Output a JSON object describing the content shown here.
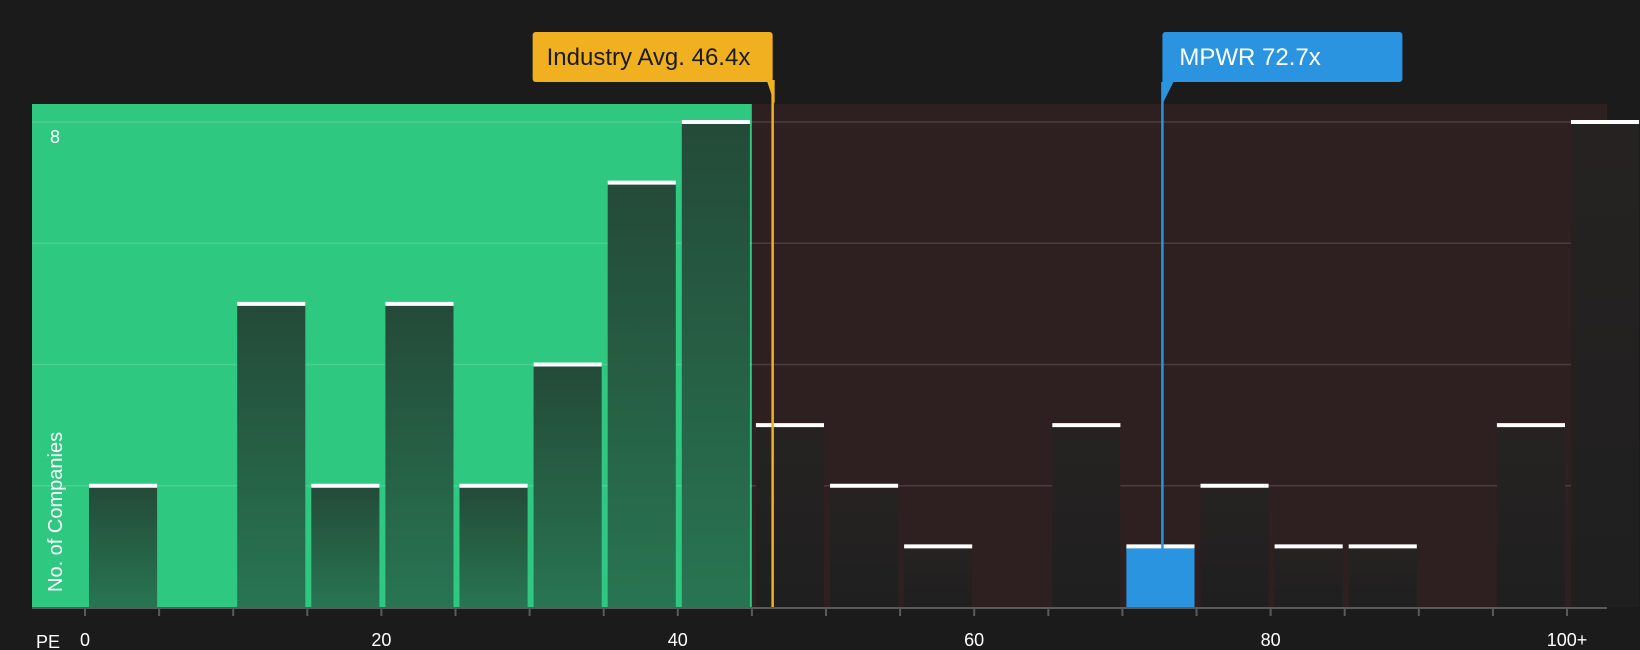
{
  "chart_data": {
    "type": "bar",
    "xlabel": "PE",
    "ylabel": "No. of Companies",
    "xlim": [
      0,
      100
    ],
    "ylim": [
      0,
      8
    ],
    "x_ticks": [
      0,
      20,
      40,
      60,
      80,
      100
    ],
    "x_tick_labels": [
      "0",
      "20",
      "40",
      "60",
      "80",
      "100+"
    ],
    "y_ticks_labeled": [
      8
    ],
    "y_tick_labels": [
      "8"
    ],
    "grid": true,
    "bin_width": 5,
    "bins": [
      {
        "start": 0,
        "count": 2
      },
      {
        "start": 5,
        "count": 0
      },
      {
        "start": 10,
        "count": 5
      },
      {
        "start": 15,
        "count": 2
      },
      {
        "start": 20,
        "count": 5
      },
      {
        "start": 25,
        "count": 2
      },
      {
        "start": 30,
        "count": 4
      },
      {
        "start": 35,
        "count": 7
      },
      {
        "start": 40,
        "count": 8
      },
      {
        "start": 45,
        "count": 3
      },
      {
        "start": 50,
        "count": 2
      },
      {
        "start": 55,
        "count": 1
      },
      {
        "start": 60,
        "count": 0
      },
      {
        "start": 65,
        "count": 3
      },
      {
        "start": 70,
        "count": 1,
        "highlight": true
      },
      {
        "start": 75,
        "count": 2
      },
      {
        "start": 80,
        "count": 1
      },
      {
        "start": 85,
        "count": 1
      },
      {
        "start": 90,
        "count": 0
      },
      {
        "start": 95,
        "count": 3
      },
      {
        "start": 100,
        "count": 8
      }
    ],
    "zones": [
      {
        "name": "below-average",
        "from": 0,
        "to": 45,
        "color": "#2ec880"
      },
      {
        "name": "above-average",
        "from": 45,
        "to": 100,
        "color": "#2e1f20"
      }
    ],
    "reference_lines": [
      {
        "name": "industry-average",
        "label": "Industry Avg. 46.4x",
        "value": 46.4,
        "color": "#f0b020",
        "text_color": "#1b1b1b"
      },
      {
        "name": "company",
        "label": "MPWR 72.7x",
        "value": 72.7,
        "color": "#2a94e0",
        "text_color": "#ffffff"
      }
    ],
    "colors": {
      "background": "#1b1b1b",
      "bar_green_zone_top": "#244a38",
      "bar_green_zone_bottom": "#287552",
      "bar_dark": "#242424",
      "bar_highlight": "#2a94e0",
      "bar_cap": "#ffffff",
      "axis": "#5a5a5a",
      "grid": "#4a4a4a"
    }
  }
}
